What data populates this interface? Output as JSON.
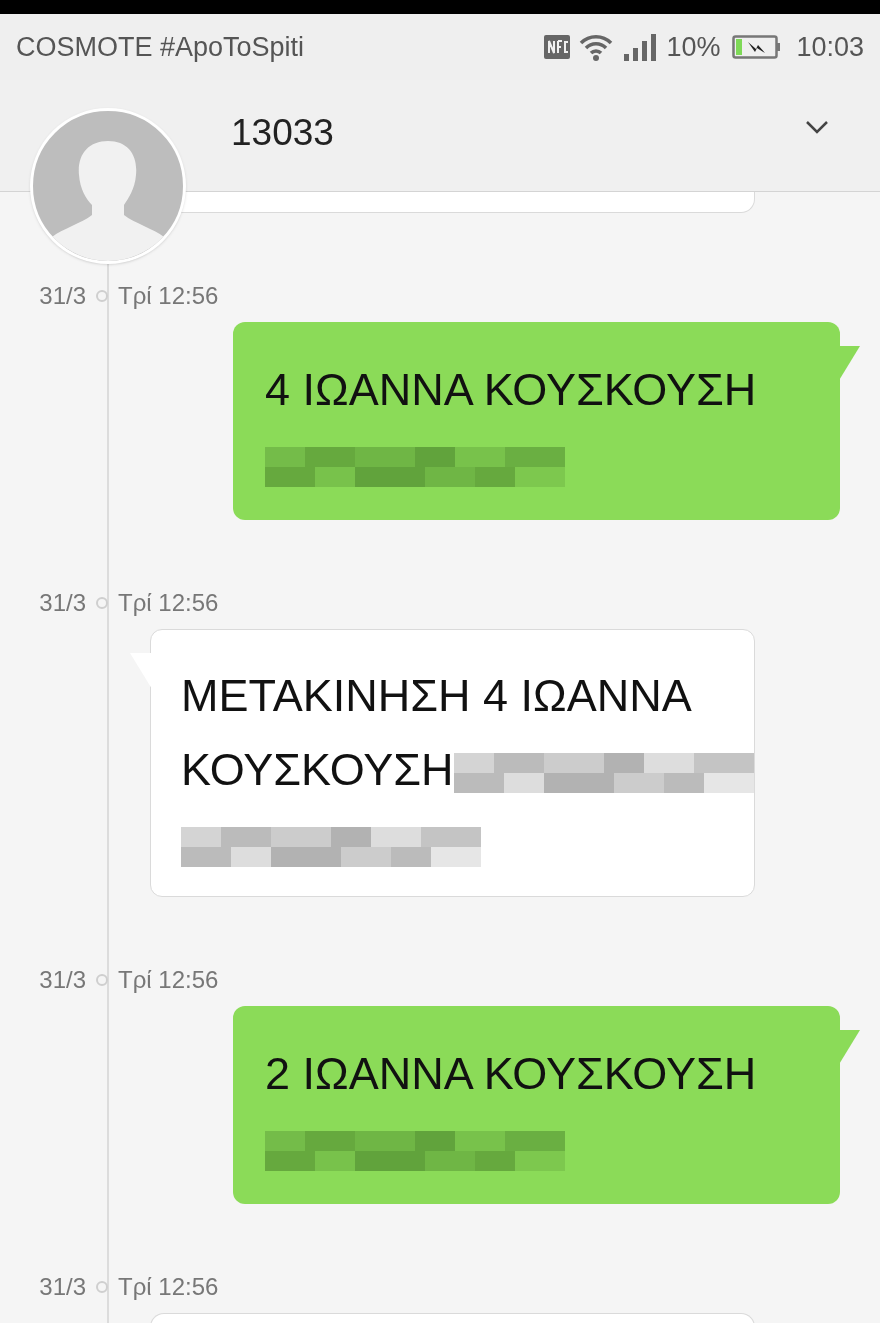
{
  "status_bar": {
    "carrier": "COSMOTE #ApoToSpiti",
    "battery": "10%",
    "time": "10:03"
  },
  "header": {
    "title": "13033"
  },
  "messages": [
    {
      "date": "31/3",
      "time": "Τρί 12:56",
      "kind": "sent",
      "lines": [
        [
          {
            "kind": "text",
            "text": "4 ΙΩΑΝΝΑ ΚΟΥΣΚΟΥΣΗ"
          }
        ],
        [
          {
            "kind": "redacted"
          }
        ]
      ]
    },
    {
      "date": "31/3",
      "time": "Τρί 12:56",
      "kind": "received",
      "lines": [
        [
          {
            "kind": "text",
            "text": "ΜΕΤΑΚΙΝΗΣΗ 4 ΙΩΑΝΝΑ"
          }
        ],
        [
          {
            "kind": "text",
            "text": "ΚΟΥΣΚΟΥΣΗ"
          },
          {
            "kind": "redacted"
          }
        ],
        [
          {
            "kind": "redacted"
          }
        ]
      ]
    },
    {
      "date": "31/3",
      "time": "Τρί 12:56",
      "kind": "sent",
      "lines": [
        [
          {
            "kind": "text",
            "text": "2 ΙΩΑΝΝΑ ΚΟΥΣΚΟΥΣΗ"
          }
        ],
        [
          {
            "kind": "redacted"
          }
        ]
      ]
    },
    {
      "date": "31/3",
      "time": "Τρί 12:56",
      "kind": "received",
      "partial": true
    }
  ]
}
